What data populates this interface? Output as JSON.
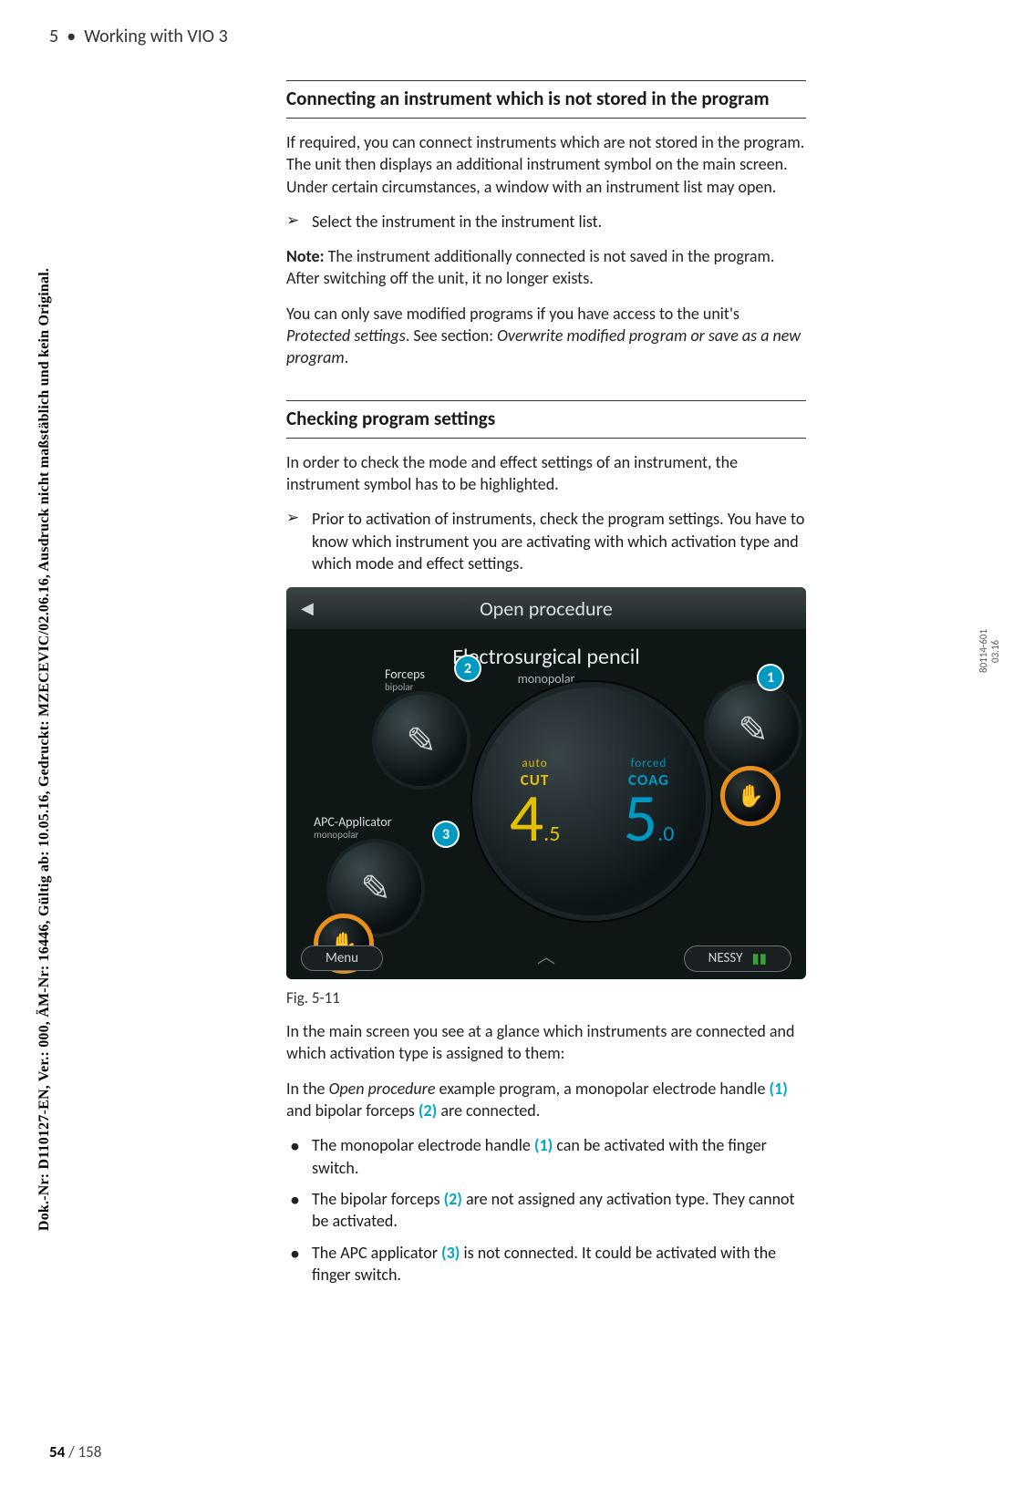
{
  "header": {
    "chapter_num": "5",
    "bullet": "•",
    "chapter_title": "Working with VIO 3"
  },
  "side": {
    "left_text": "Dok.-Nr: D110127-EN, Ver.: 000, ÄM-Nr: 16446, Gültig ab: 10.05.16, Gedruckt: MZECEVIC/02.06.16, Ausdruck nicht maßstäblich und kein Original.",
    "right_code": "80114-601",
    "right_date": "03.16"
  },
  "footer": {
    "page_current": "54",
    "page_sep": " / ",
    "page_total": "158"
  },
  "sec1": {
    "title": "Connecting an instrument which is not stored in the program",
    "p1": "If required, you can connect instruments which are not stored in the program. The unit then displays an additional instrument symbol on the main screen. Under certain circumstances, a window with an instrument list may open.",
    "li1": "Select the instrument in the instrument list.",
    "note_label": "Note:",
    "note_text": " The instrument additionally connected is not saved in the program. After switching off the unit, it no longer exists.",
    "p3a": "You can only save modified programs if you have access to the unit's ",
    "p3i1": "Protected settings",
    "p3b": ". See section: ",
    "p3i2": "Overwrite modified program or save as a new program",
    "p3c": "."
  },
  "sec2": {
    "title": "Checking program settings",
    "p1": "In order to check the mode and effect settings of an instrument, the instrument symbol has to be highlighted.",
    "li1": "Prior to activation of instruments, check the program settings. You have to know which instrument you are activating with which activation type and which mode and effect settings.",
    "fig_caption": "Fig. 5-11",
    "p2": "In the main screen you see at a glance which instruments are connected and which activation type is assigned to them:",
    "p3a": "In the ",
    "p3i": "Open procedure",
    "p3b": " example program, a monopolar electrode handle ",
    "p3r1": "(1)",
    "p3c": " and bipolar forceps ",
    "p3r2": "(2)",
    "p3d": " are connected.",
    "b1a": "The monopolar electrode handle ",
    "b1r": "(1)",
    "b1b": " can be activated with the finger switch.",
    "b2a": "The bipolar forceps ",
    "b2r": "(2)",
    "b2b": " are not assigned any activation type. They cannot be activated.",
    "b3a": "The APC applicator ",
    "b3r": "(3)",
    "b3b": " is not connected. It could be activated with the finger switch."
  },
  "fig": {
    "topbar": "Open procedure",
    "menu": "Menu",
    "nessy": "NESSY",
    "inst_title": "Electrosurgical pencil",
    "inst_sub": "monopolar",
    "forceps": "Forceps",
    "forceps_sub": "bipolar",
    "apc": "APC-Applicator",
    "apc_sub": "monopolar",
    "cut_mode_sm": "auto",
    "cut_mode_bg": "CUT",
    "cut_val_int": "4",
    "cut_val_dec": ".5",
    "coag_mode_sm": "forced",
    "coag_mode_bg": "COAG",
    "coag_val_int": "5",
    "coag_val_dec": ".0",
    "c1": "1",
    "c2": "2",
    "c3": "3"
  }
}
